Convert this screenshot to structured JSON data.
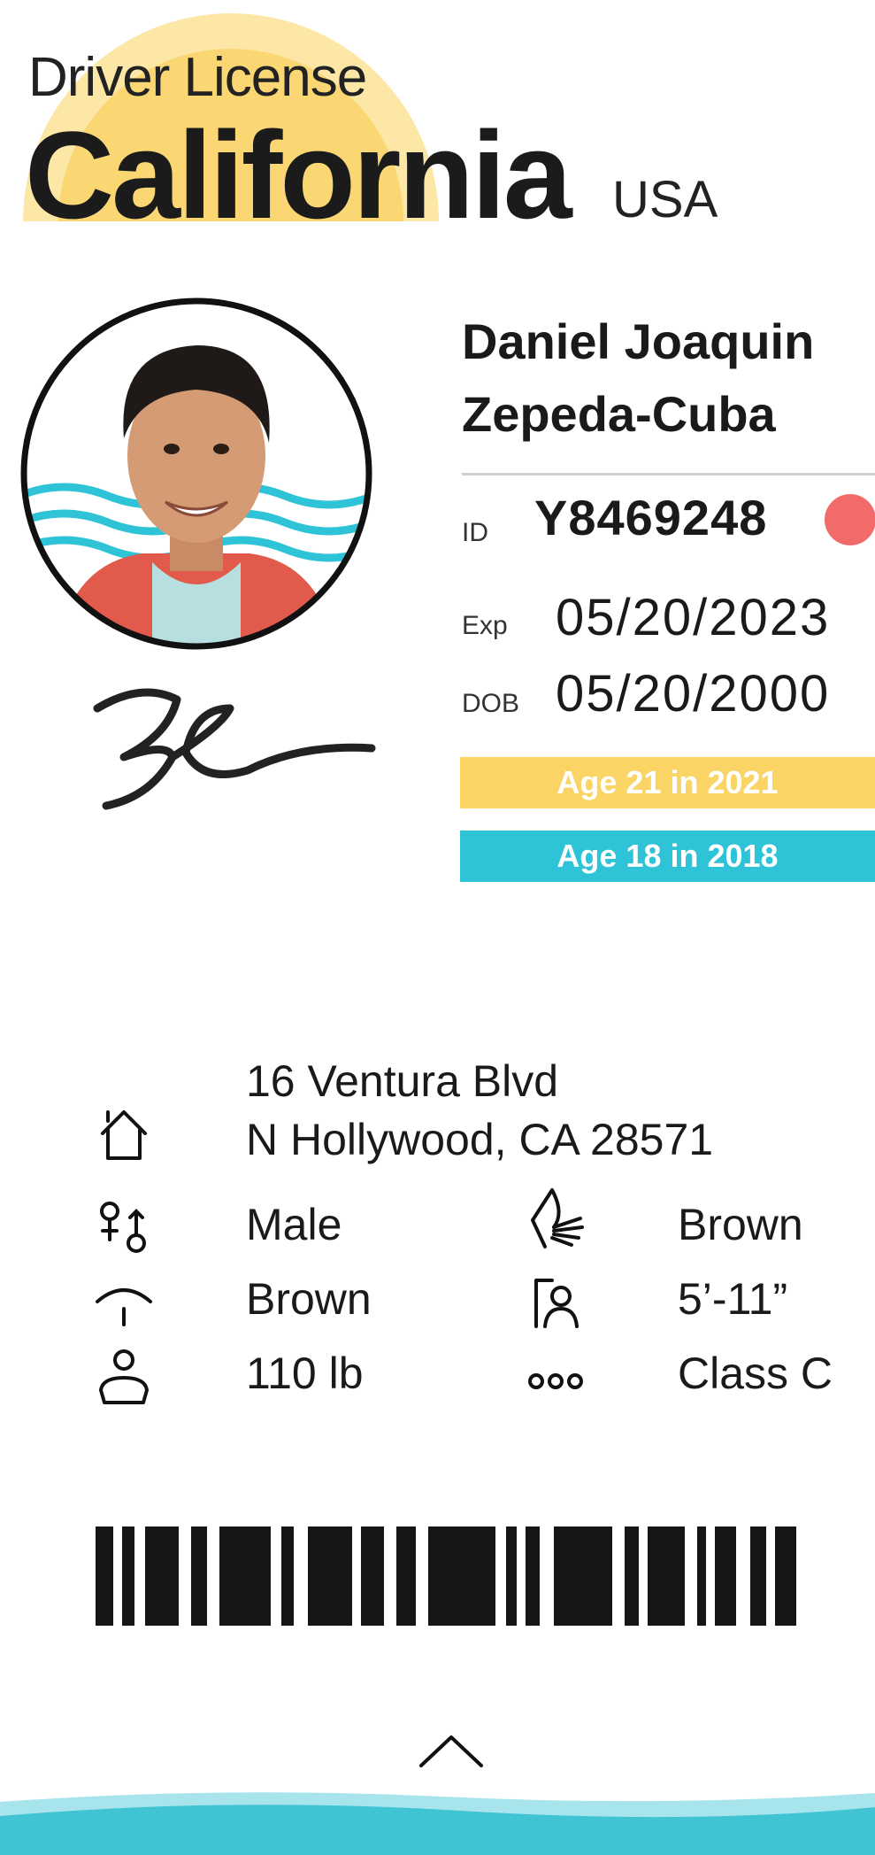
{
  "header": {
    "subtitle": "Driver License",
    "state": "California",
    "country": "USA"
  },
  "holder": {
    "first_name_line": "Daniel Joaquin",
    "last_name_line": "Zepeda-Cuba"
  },
  "fields": {
    "id_label": "ID",
    "id_value": "Y8469248",
    "exp_label": "Exp",
    "exp_value": "05/20/2023",
    "dob_label": "DOB",
    "dob_value": "05/20/2000"
  },
  "bands": {
    "age21": "Age 21 in 2021",
    "age18": "Age 18 in 2018"
  },
  "address": {
    "line1": "16 Ventura Blvd",
    "line2": "N Hollywood, CA 28571"
  },
  "details": {
    "sex": "Male",
    "hair": "Brown",
    "eyes": "Brown",
    "height": "5’-11”",
    "weight": "110 lb",
    "class": "Class C"
  },
  "colors": {
    "sun": "#fbd774",
    "age21_band": "#fad465",
    "age18_band": "#2ec3d6",
    "status_dot": "#f26b6b",
    "wave": "#40c4d4"
  },
  "icons": {
    "address": "house-icon",
    "sex": "gender-icon",
    "hair": "hair-icon",
    "eyes": "eye-icon",
    "height": "height-icon",
    "weight": "weight-icon",
    "class": "license-class-icon",
    "expand": "chevron-up-icon"
  }
}
